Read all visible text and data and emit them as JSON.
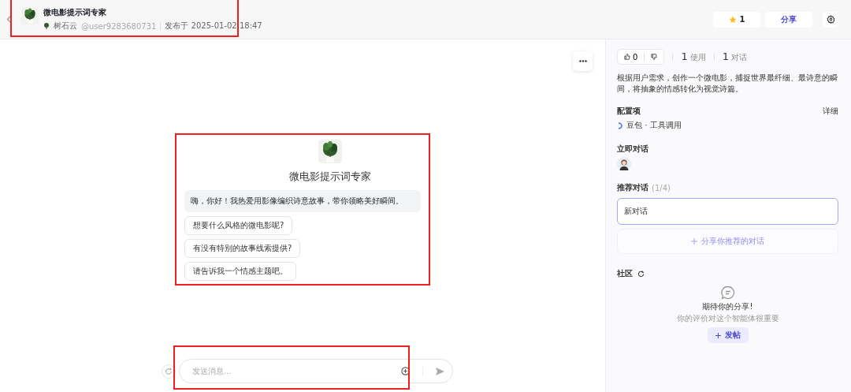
{
  "header": {
    "title": "微电影提示词专家",
    "author": "树石云",
    "handle": "@user9283680731",
    "published": "发布于 2025-01-02 18:47",
    "star_count": "1",
    "share": "分享"
  },
  "chat": {
    "bot_name": "微电影提示词专家",
    "greeting": "嗨，你好！我热爱用影像编织诗意故事，带你领略美好瞬间。",
    "suggestions": [
      "想要什么风格的微电影呢?",
      "有没有特别的故事线索提供?",
      "请告诉我一个情感主题吧。"
    ],
    "input": {
      "placeholder": "发送消息..."
    }
  },
  "sidebar": {
    "likes": "0",
    "stats": [
      {
        "value": "1",
        "label": "使用"
      },
      {
        "value": "1",
        "label": "对话"
      }
    ],
    "description": "根据用户需求，创作一个微电影，捕捉世界最纤细、最诗意的瞬间，将抽象的情感转化为视觉诗篇。",
    "config": {
      "title": "配置项",
      "detail": "详细",
      "model": "豆包 · 工具调用"
    },
    "quick_chat": {
      "title": "立即对话"
    },
    "recommended": {
      "title": "推荐对话",
      "count": "(1/4)",
      "items": [
        {
          "label": "新对话",
          "selected": true
        }
      ],
      "add": "分享你推荐的对话"
    },
    "community": {
      "title": "社区",
      "empty_title": "期待你的分享!",
      "empty_subtitle": "你的评价对这个智能体很重要",
      "post": "发帖"
    }
  }
}
